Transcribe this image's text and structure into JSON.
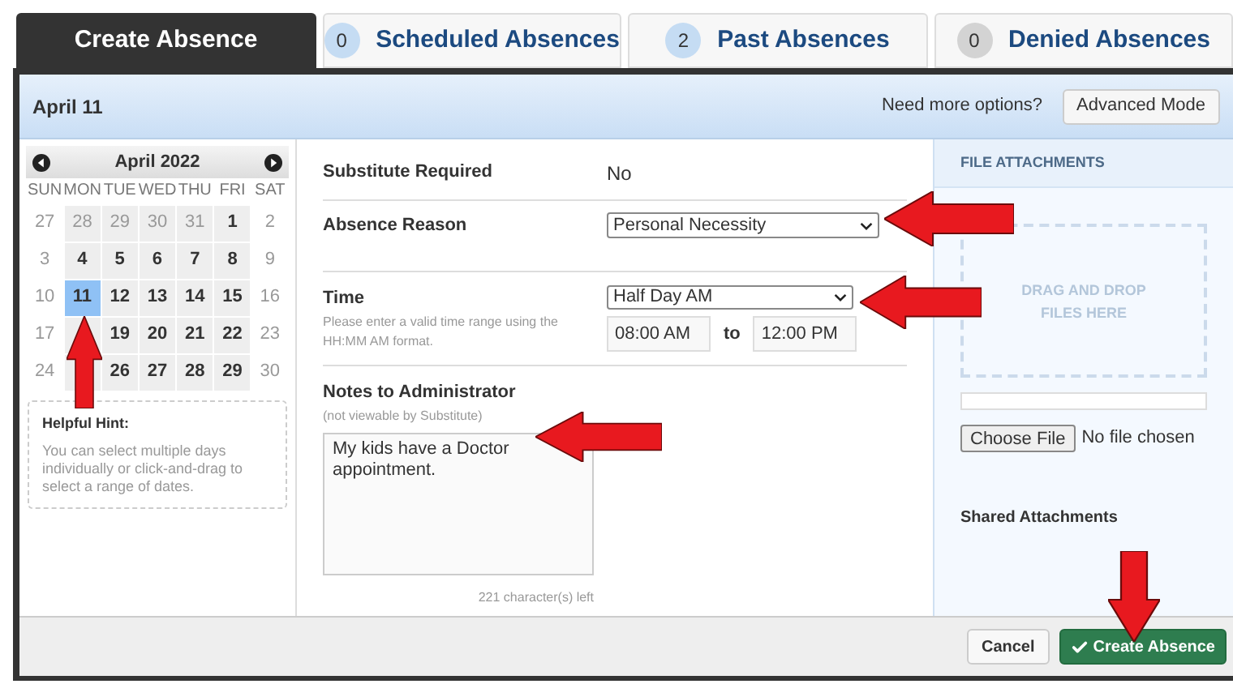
{
  "tabs": [
    {
      "label": "Create Absence",
      "selected": true
    },
    {
      "label": "Scheduled Absences",
      "count": "0",
      "color": "#c5dcf3",
      "selected": false
    },
    {
      "label": "Past Absences",
      "count": "2",
      "color": "#c5dcf3",
      "selected": false
    },
    {
      "label": "Denied Absences",
      "count": "0",
      "color": "#d3d3d3",
      "selected": false
    }
  ],
  "header": {
    "title": "April 11",
    "hint": "Need more options?",
    "button": "Advanced Mode"
  },
  "calendar": {
    "month": "April 2022",
    "weekdays": [
      "SUN",
      "MON",
      "TUE",
      "WED",
      "THU",
      "FRI",
      "SAT"
    ],
    "weeks": [
      [
        {
          "label": "27",
          "kind": "weekend",
          "selected": false
        },
        {
          "label": "28",
          "kind": "other_month",
          "selected": false
        },
        {
          "label": "29",
          "kind": "other_month",
          "selected": false
        },
        {
          "label": "30",
          "kind": "other_month",
          "selected": false
        },
        {
          "label": "31",
          "kind": "other_month",
          "selected": false
        },
        {
          "label": "1",
          "kind": "weekday",
          "selected": false
        },
        {
          "label": "2",
          "kind": "weekend",
          "selected": false
        }
      ],
      [
        {
          "label": "3",
          "kind": "weekend",
          "selected": false
        },
        {
          "label": "4",
          "kind": "weekday",
          "selected": false
        },
        {
          "label": "5",
          "kind": "weekday",
          "selected": false
        },
        {
          "label": "6",
          "kind": "weekday",
          "selected": false
        },
        {
          "label": "7",
          "kind": "weekday",
          "selected": false
        },
        {
          "label": "8",
          "kind": "weekday",
          "selected": false
        },
        {
          "label": "9",
          "kind": "weekend",
          "selected": false
        }
      ],
      [
        {
          "label": "10",
          "kind": "weekend",
          "selected": false
        },
        {
          "label": "11",
          "kind": "weekday",
          "selected": true
        },
        {
          "label": "12",
          "kind": "weekday",
          "selected": false
        },
        {
          "label": "13",
          "kind": "weekday",
          "selected": false
        },
        {
          "label": "14",
          "kind": "weekday",
          "selected": false
        },
        {
          "label": "15",
          "kind": "weekday",
          "selected": false
        },
        {
          "label": "16",
          "kind": "weekend",
          "selected": false
        }
      ],
      [
        {
          "label": "17",
          "kind": "weekend",
          "selected": false
        },
        {
          "kind": "weekday"
        },
        {
          "label": "19",
          "kind": "weekday",
          "selected": false
        },
        {
          "label": "20",
          "kind": "weekday",
          "selected": false
        },
        {
          "label": "21",
          "kind": "weekday",
          "selected": false
        },
        {
          "label": "22",
          "kind": "weekday",
          "selected": false
        },
        {
          "label": "23",
          "kind": "weekend",
          "selected": false
        }
      ],
      [
        {
          "label": "24",
          "kind": "weekend",
          "selected": false
        },
        {
          "kind": "weekday"
        },
        {
          "label": "26",
          "kind": "weekday",
          "selected": false
        },
        {
          "label": "27",
          "kind": "weekday",
          "selected": false
        },
        {
          "label": "28",
          "kind": "weekday",
          "selected": false
        },
        {
          "label": "29",
          "kind": "weekday",
          "selected": false
        },
        {
          "label": "30",
          "kind": "weekend",
          "selected": false
        }
      ]
    ],
    "hint_title": "Helpful Hint:",
    "hint_text": "You can select multiple days individually or click-and-drag to select a range of dates."
  },
  "form": {
    "substitute_label": "Substitute Required",
    "substitute_value": "No",
    "reason_label": "Absence Reason",
    "reason_value": "Personal Necessity",
    "time_label": "Time",
    "time_help": "Please enter a valid time range using the HH:MM AM format.",
    "time_value": "Half Day AM",
    "time_from": "08:00 AM",
    "time_to_label": "to",
    "time_to": "12:00 PM",
    "notes_label": "Notes to Administrator",
    "notes_sub": "(not viewable by Substitute)",
    "notes_value": "My kids have a Doctor appointment.",
    "notes_left": "221 character(s) left"
  },
  "attachments": {
    "title": "FILE ATTACHMENTS",
    "drop": "DRAG AND DROP FILES HERE",
    "choose": "Choose File",
    "no_file": "No file chosen",
    "shared": "Shared Attachments"
  },
  "footer": {
    "cancel": "Cancel",
    "create": "Create Absence"
  }
}
